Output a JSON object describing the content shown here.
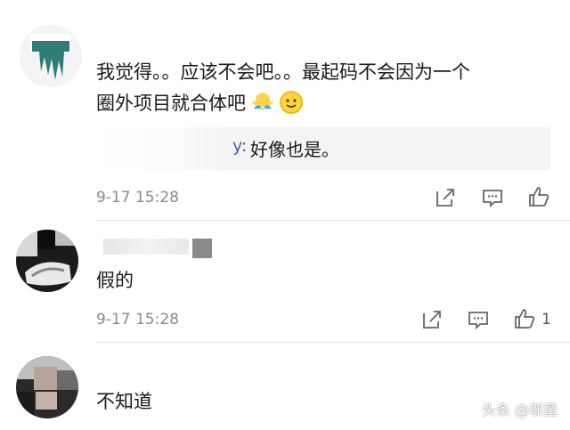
{
  "comments": [
    {
      "text_line1": "我觉得。。应该不会吧。。最起码不会因为一个",
      "text_line2": "圈外项目就合体吧",
      "reply": {
        "user_suffix": "y:",
        "text": "好像也是。"
      },
      "timestamp": "9-17 15:28",
      "likes": ""
    },
    {
      "text_line1": "假的",
      "timestamp": "9-17 15:28",
      "likes": "1"
    },
    {
      "text_line1": "不知道"
    }
  ],
  "icons": {
    "share": "share-icon",
    "comment": "comment-icon",
    "like": "thumbs-up-icon"
  },
  "emoji": [
    "shrug-emoji",
    "smile-emoji"
  ],
  "watermark": "头条 @邬童",
  "colors": {
    "background": "#ffffff",
    "meta_text": "#8a8a8a",
    "reply_bg": "#f4f4f4",
    "reply_user": "#3a6ea5"
  }
}
